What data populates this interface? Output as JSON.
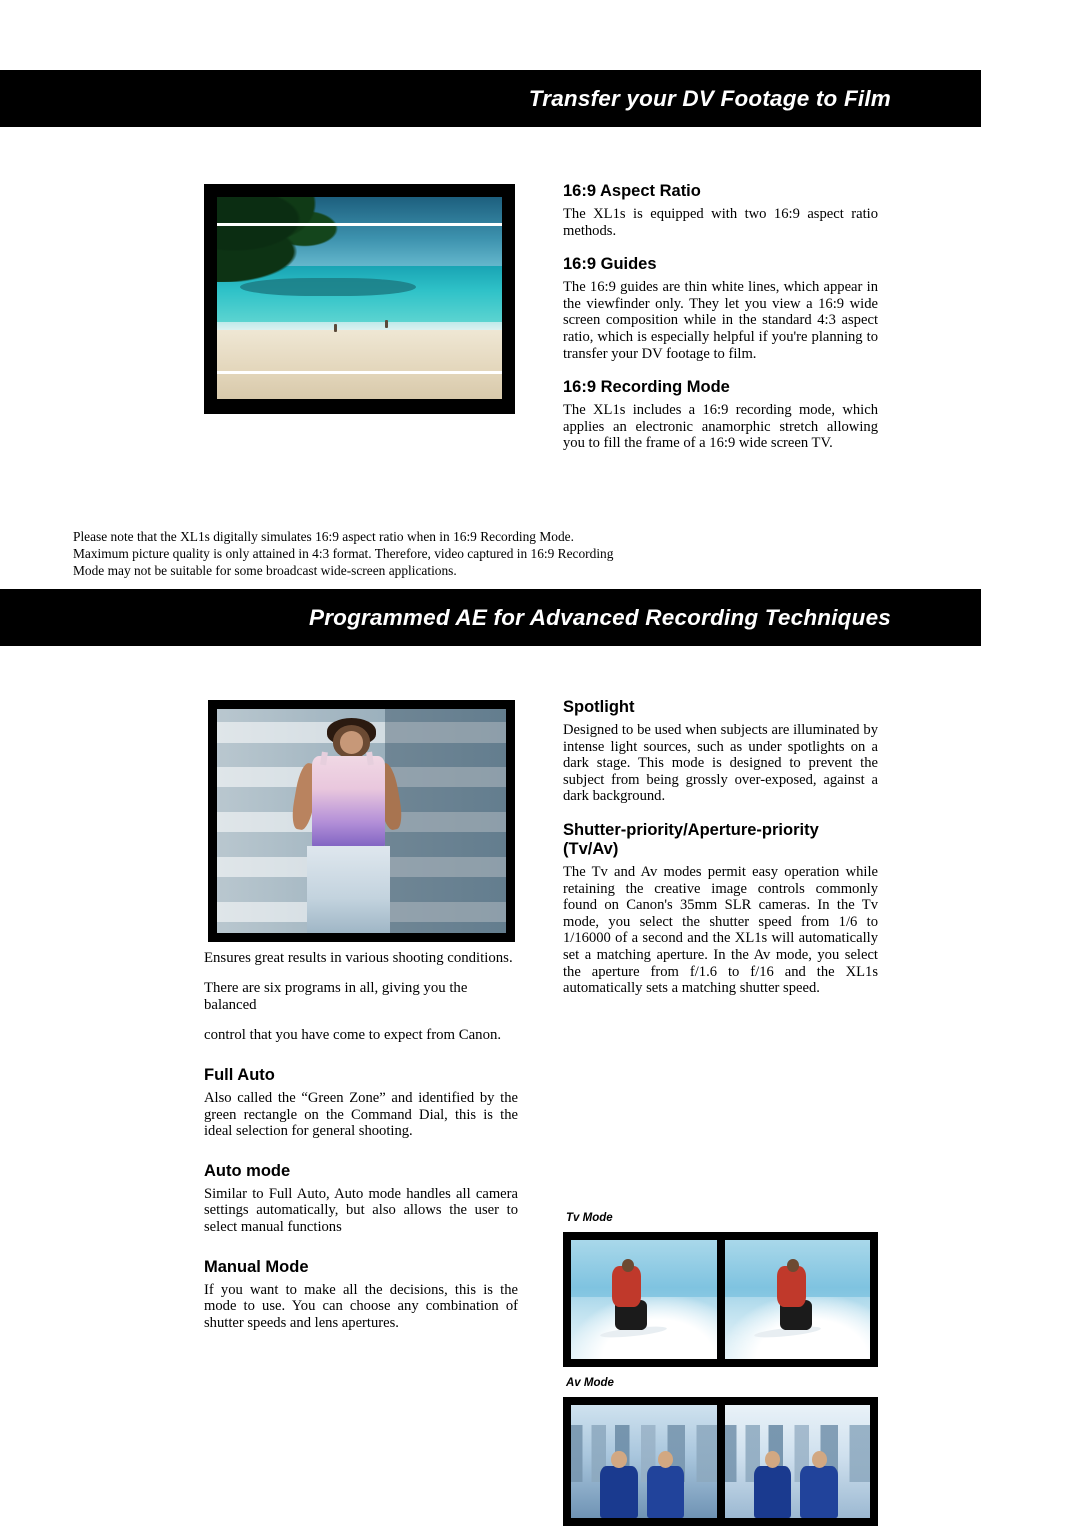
{
  "banners": {
    "section1_title": "Transfer your DV Footage to Film",
    "section2_title": "Programmed AE for Advanced Recording Techniques"
  },
  "section1": {
    "blocks": [
      {
        "heading": "16:9 Aspect Ratio",
        "body": "The XL1s is equipped with two 16:9 aspect ratio methods."
      },
      {
        "heading": "16:9 Guides",
        "body": "The 16:9 guides are thin white lines, which appear in the viewfinder only. They let you view a 16:9 wide screen composition while in the standard 4:3 aspect ratio, which is especially helpful if you're planning to transfer your DV footage to film."
      },
      {
        "heading": "16:9 Recording Mode",
        "body": "The XL1s includes a 16:9 recording mode, which applies an electronic anamorphic stretch allowing you to fill the frame of a 16:9 wide screen TV."
      }
    ],
    "note": "Please note that the XL1s digitally simulates 16:9 aspect ratio when in 16:9 Recording Mode. Maximum picture quality is only attained in 4:3 format. Therefore, video captured in 16:9 Recording Mode may not be suitable for some broadcast wide-screen applications.",
    "image_alt": "beach-scene-with-16-9-guide-lines"
  },
  "section2": {
    "lead_paragraphs": [
      "Ensures great results in various shooting conditions.",
      "There are six programs in all, giving you the balanced",
      "control that you have come to expect from Canon."
    ],
    "left_blocks": [
      {
        "heading": "Full Auto",
        "body": "Also called the “Green Zone” and identified by the green rectangle on the Command Dial, this is the ideal selection for general shooting."
      },
      {
        "heading": "Auto mode",
        "body": "Similar to Full Auto, Auto mode handles all camera settings automatically, but also allows the user to select manual functions"
      },
      {
        "heading": "Manual Mode",
        "body": "If you want to make all the decisions, this is the mode to use. You can choose any combination of shutter speeds and lens apertures."
      }
    ],
    "right_blocks": [
      {
        "heading": "Spotlight",
        "body": "Designed to be used when subjects are illuminated by intense light sources, such as under spotlights on a dark stage. This mode is designed to prevent the subject from being grossly over-exposed, against a dark background."
      },
      {
        "heading": "Shutter-priority/Aperture-priority",
        "heading2": "(Tv/Av)",
        "body": "The Tv and Av modes permit easy operation while retaining the creative image controls commonly found on Canon's 35mm SLR cameras. In the Tv mode, you select the shutter speed from 1/6 to 1/16000 of a second and the XL1s will automatically set a matching aperture. In the Av mode, you select the aperture from f/1.6 to f/16 and the XL1s automatically sets a matching shutter speed."
      }
    ],
    "image_alt": "woman-standing-against-striped-wall",
    "samples": [
      {
        "label": "Tv Mode",
        "image_alt_left": "surfer-slow-shutter",
        "image_alt_right": "surfer-fast-shutter"
      },
      {
        "label": "Av Mode",
        "image_alt_left": "couple-shallow-depth-of-field",
        "image_alt_right": "couple-deep-depth-of-field"
      }
    ]
  },
  "colors": {
    "banner_background": "#000000",
    "banner_text": "#ffffff",
    "body_text": "#000000",
    "page_background": "#ffffff"
  }
}
